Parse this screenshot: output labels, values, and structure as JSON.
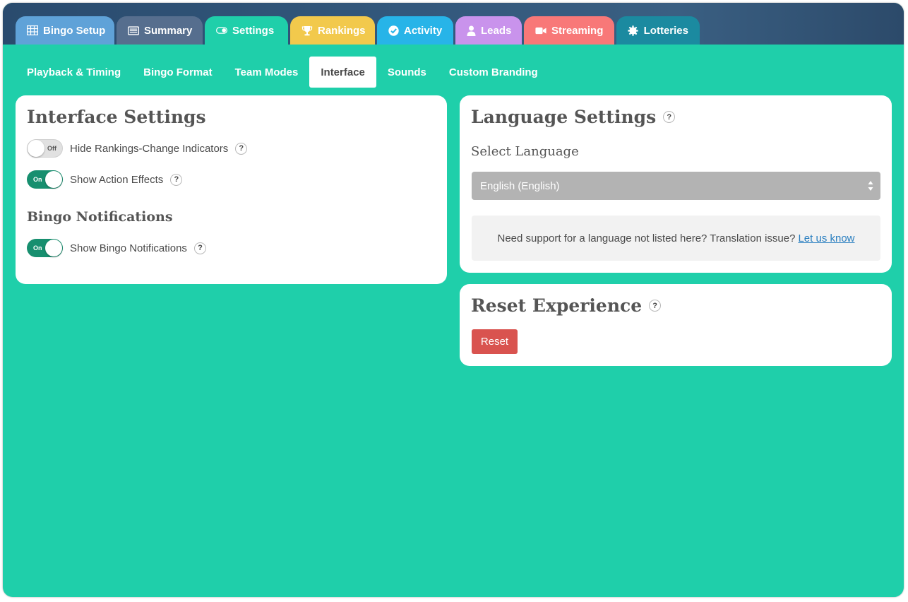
{
  "top_tabs": [
    {
      "label": "Bingo Setup",
      "icon": "table-icon",
      "color": "#5fa2d8"
    },
    {
      "label": "Summary",
      "icon": "list-icon",
      "color": "#566e8e"
    },
    {
      "label": "Settings",
      "icon": "toggle-icon",
      "color": "#1fcfaa",
      "active": true
    },
    {
      "label": "Rankings",
      "icon": "trophy-icon",
      "color": "#f2c94c"
    },
    {
      "label": "Activity",
      "icon": "check-circle-icon",
      "color": "#27b4e8"
    },
    {
      "label": "Leads",
      "icon": "user-icon",
      "color": "#c993ec"
    },
    {
      "label": "Streaming",
      "icon": "video-icon",
      "color": "#f87878"
    },
    {
      "label": "Lotteries",
      "icon": "gear-icon",
      "color": "#1b8aa0"
    }
  ],
  "sub_tabs": [
    {
      "label": "Playback & Timing"
    },
    {
      "label": "Bingo Format"
    },
    {
      "label": "Team Modes"
    },
    {
      "label": "Interface",
      "active": true
    },
    {
      "label": "Sounds"
    },
    {
      "label": "Custom Branding"
    }
  ],
  "interface_settings": {
    "title": "Interface Settings",
    "toggles": [
      {
        "label": "Hide Rankings-Change Indicators",
        "state": "Off"
      },
      {
        "label": "Show Action Effects",
        "state": "On"
      }
    ],
    "notifications_title": "Bingo Notifications",
    "notification_toggle": {
      "label": "Show Bingo Notifications",
      "state": "On"
    }
  },
  "language_settings": {
    "title": "Language Settings",
    "select_label": "Select Language",
    "selected_value": "English (English)",
    "note_text": "Need support for a language not listed here? Translation issue?",
    "note_link": "Let us know"
  },
  "reset": {
    "title": "Reset Experience",
    "button_label": "Reset"
  },
  "help_symbol": "?",
  "colors": {
    "background": "#1fcfaa",
    "toggle_on": "#178f6f",
    "reset_button": "#d9534f",
    "link": "#2a7fc0"
  }
}
